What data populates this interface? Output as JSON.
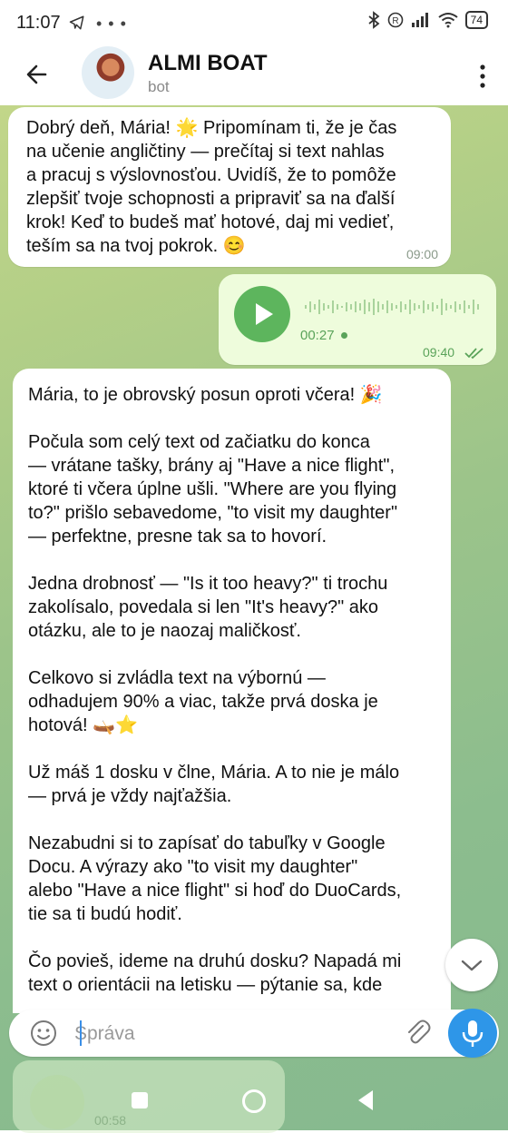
{
  "status_bar": {
    "time": "11:07",
    "dots": "• • •",
    "battery": "74"
  },
  "chat": {
    "title": "ALMI BOAT",
    "subtitle": "bot"
  },
  "messages": [
    {
      "direction": "incoming",
      "text": "Dobrý deň, Mária! 🌟 Pripomínam ti, že je čas\nna učenie angličtiny — prečítaj si text nahlas\na pracuj s výslovnosťou. Uvidíš, že to pomôže\nzlepšiť tvoje schopnosti a pripraviť sa na ďalší\nkrok! Keď to budeš mať hotové, daj mi vedieť,\nteším sa na tvoj pokrok. 😊",
      "time": "09:00"
    },
    {
      "direction": "outgoing",
      "type": "voice",
      "duration": "00:27",
      "time": "09:40",
      "status_icon": "double-check-icon"
    },
    {
      "direction": "incoming",
      "text": "Mária, to je obrovský posun oproti včera! 🎉\n\nPočula som celý text od začiatku do konca\n— vrátane tašky, brány aj \"Have a nice flight\",\nktoré ti včera úplne ušli. \"Where are you flying\nto?\" prišlo sebavedome, \"to visit my daughter\"\n— perfektne, presne tak sa to hovorí.\n\nJedna drobnosť — \"Is it too heavy?\" ti trochu\nzakolísalo, povedala si len \"It's heavy?\" ako\notázku, ale to je naozaj maličkosť.\n\nCelkovo si zvládla text na výbornú —\nodhadujem 90% a viac, takže prvá doska je\nhotová! 🛶⭐\n\nUž máš 1 dosku v člne, Mária. A to nie je málo\n— prvá je vždy najťažšia.\n\nNezabudni si to zapísať do tabuľky v Google\nDocu. A výrazy ako \"to visit my daughter\"\nalebo \"Have a nice flight\" si hoď do DuoCards,\ntie sa ti budú hodiť.\n\nČo povieš, ideme na druhú dosku? Napadá mi\ntext o orientácii na letisku — pýtanie sa, kde"
    }
  ],
  "composer": {
    "placeholder": "Správa"
  },
  "background_preview": {
    "duration": "00:58"
  }
}
